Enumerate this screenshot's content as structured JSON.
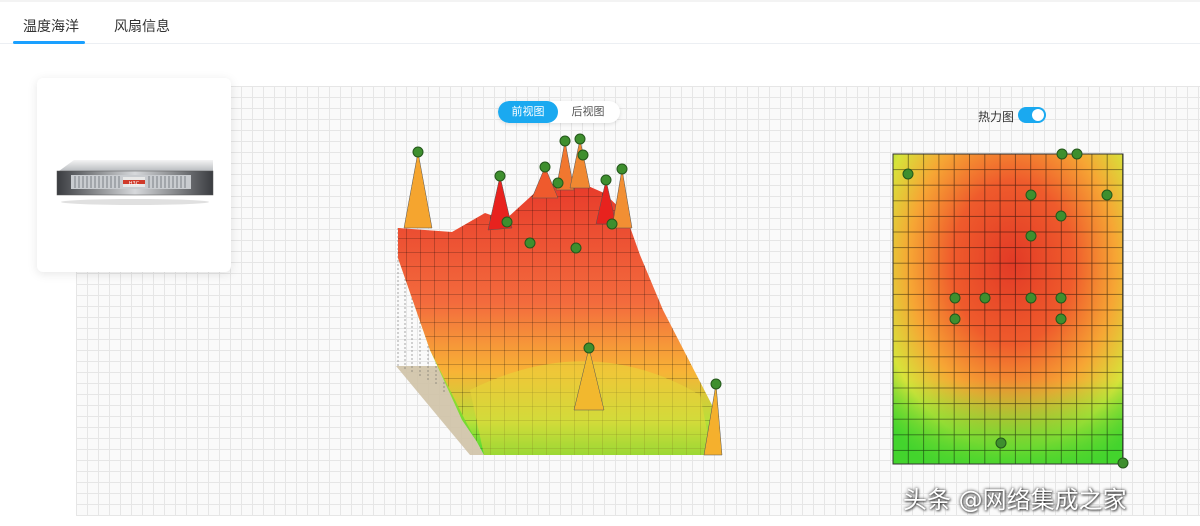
{
  "tabs": [
    {
      "label": "温度海洋",
      "active": true
    },
    {
      "label": "风扇信息",
      "active": false
    }
  ],
  "view_toggle": {
    "front_label": "前视图",
    "back_label": "后视图",
    "selected": "前视图"
  },
  "heatmap_toggle": {
    "label": "热力图",
    "enabled": true
  },
  "device": {
    "brand_mark": "H3C"
  },
  "watermark": "头条 @网络集成之家",
  "colors": {
    "accent": "#1aa9f0",
    "hot": "#e53422",
    "warm": "#f7a92c",
    "cool": "#6fd23a",
    "sensor": "#3e8f2e"
  }
}
